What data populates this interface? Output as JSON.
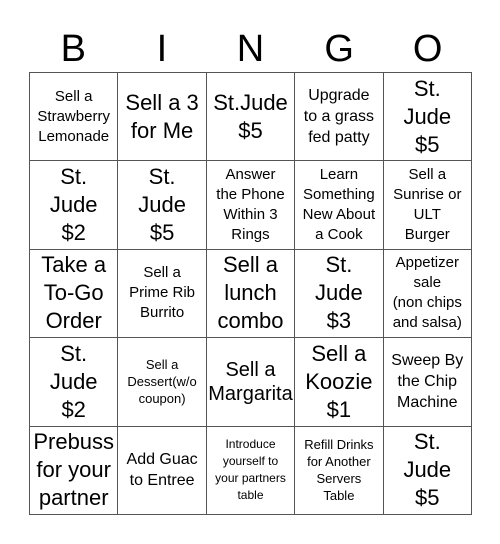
{
  "header": [
    "B",
    "I",
    "N",
    "G",
    "O"
  ],
  "cells": [
    {
      "text": "Sell a\nStrawberry\nLemonade",
      "size": "s-s"
    },
    {
      "text": "Sell a 3\nfor Me",
      "size": "s-xl"
    },
    {
      "text": "St.Jude\n$5",
      "size": "s-xl"
    },
    {
      "text": "Upgrade\nto a grass\nfed patty",
      "size": "s-m"
    },
    {
      "text": "St.\nJude\n$5",
      "size": "s-xl"
    },
    {
      "text": "St.\nJude\n$2",
      "size": "s-xl"
    },
    {
      "text": "St.\nJude\n$5",
      "size": "s-xl"
    },
    {
      "text": "Answer\nthe Phone\nWithin 3\nRings",
      "size": "s-s"
    },
    {
      "text": "Learn\nSomething\nNew About\na Cook",
      "size": "s-s"
    },
    {
      "text": "Sell a\nSunrise or\nULT\nBurger",
      "size": "s-s"
    },
    {
      "text": "Take a\nTo-Go\nOrder",
      "size": "s-xl"
    },
    {
      "text": "Sell a\nPrime Rib\nBurrito",
      "size": "s-s"
    },
    {
      "text": "Sell a\nlunch\ncombo",
      "size": "s-xl"
    },
    {
      "text": "St.\nJude\n$3",
      "size": "s-xl"
    },
    {
      "text": "Appetizer\nsale\n(non chips\nand salsa)",
      "size": "s-s"
    },
    {
      "text": "St.\nJude\n$2",
      "size": "s-xl"
    },
    {
      "text": "Sell a\nDessert(w/o\ncoupon)",
      "size": "s-xs"
    },
    {
      "text": "Sell a\nMargarita",
      "size": "s-l"
    },
    {
      "text": "Sell a\nKoozie\n$1",
      "size": "s-xl"
    },
    {
      "text": "Sweep By\nthe Chip\nMachine",
      "size": "s-m"
    },
    {
      "text": "Prebuss\nfor your\npartner",
      "size": "s-xl"
    },
    {
      "text": "Add Guac\nto Entree",
      "size": "s-m"
    },
    {
      "text": "Introduce\nyourself to\nyour partners\ntable",
      "size": "s-xxs"
    },
    {
      "text": "Refill Drinks\nfor Another\nServers\nTable",
      "size": "s-xs"
    },
    {
      "text": "St.\nJude\n$5",
      "size": "s-xl"
    }
  ]
}
